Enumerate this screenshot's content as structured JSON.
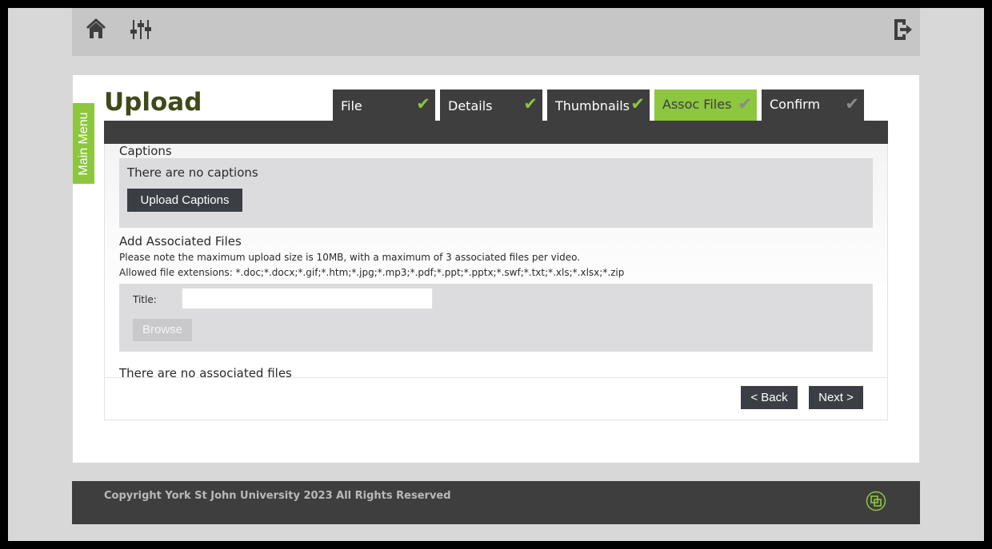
{
  "header": {
    "home_icon": "home-icon",
    "settings_icon": "sliders-icon",
    "logout_icon": "logout-icon"
  },
  "sidebar": {
    "main_menu_label": "Main Menu"
  },
  "page": {
    "title": "Upload"
  },
  "tabs": [
    {
      "label": "File",
      "state": "done"
    },
    {
      "label": "Details",
      "state": "done"
    },
    {
      "label": "Thumbnails",
      "state": "done"
    },
    {
      "label": "Assoc Files",
      "state": "active"
    },
    {
      "label": "Confirm",
      "state": "pending"
    }
  ],
  "captions": {
    "heading": "Captions",
    "empty_text": "There are no captions",
    "upload_button": "Upload Captions"
  },
  "assoc": {
    "heading": "Add Associated Files",
    "note": "Please note the maximum upload size is 10MB, with a maximum of 3 associated files per video.",
    "extensions": "Allowed file extensions: *.doc;*.docx;*.gif;*.htm;*.jpg;*.mp3;*.pdf;*.ppt;*.pptx;*.swf;*.txt;*.xls;*.xlsx;*.zip",
    "title_label": "Title:",
    "title_value": "",
    "browse_button": "Browse",
    "empty_text": "There are no associated files"
  },
  "nav": {
    "back_button": "< Back",
    "next_button": "Next >"
  },
  "footer": {
    "copyright": "Copyright York St John University 2023 All Rights Reserved",
    "logo_icon": "brand-logo-icon"
  },
  "colors": {
    "accent": "#8dc63f",
    "dark": "#3e3e3e",
    "title": "#3d4a1a"
  }
}
